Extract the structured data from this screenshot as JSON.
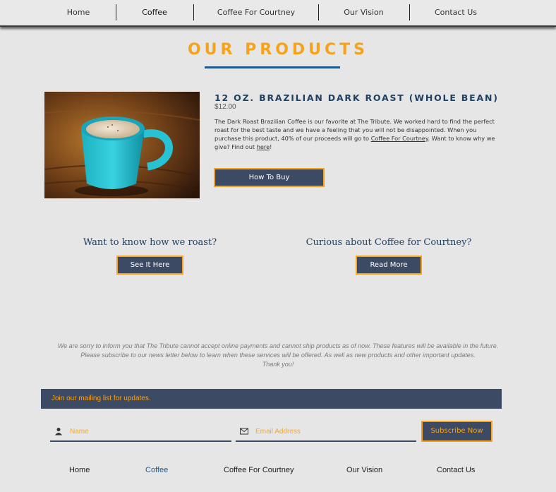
{
  "nav": {
    "items": [
      {
        "label": "Home"
      },
      {
        "label": "Coffee"
      },
      {
        "label": "Coffee For Courtney"
      },
      {
        "label": "Our Vision"
      },
      {
        "label": "Contact Us"
      }
    ]
  },
  "page_title": "OUR PRODUCTS",
  "product": {
    "name": "12 OZ. BRAZILIAN DARK ROAST (WHOLE BEAN)",
    "price": "$12.00",
    "desc_part1": "The Dark Roast Brazilian Coffee is our favorite at The Tribute. We worked hard to find the perfect roast for the best taste and we have a feeling that you will not be disappointed. When you purchase this product, 40% of our proceeds will go to ",
    "desc_link1": "Coffee For Courtney",
    "desc_part2": ". Want to know why we give? Find out ",
    "desc_link2": "here",
    "desc_part3": "!",
    "buy_label": "How To Buy"
  },
  "promos": {
    "roast_heading": "Want to know how we roast?",
    "roast_button": "See It Here",
    "courtney_heading": "Curious about Coffee for Courtney?",
    "courtney_button": "Read More"
  },
  "notice": {
    "line1": "We are sorry to inform you that The Tribute cannot accept online payments and cannot ship products as of now. These features will be available in the future.",
    "line2": "Please subscribe to our news letter below to learn when these services will be offered. As well as new products and other important updates.",
    "line3": "Thank you!"
  },
  "mailing": {
    "heading": "Join our mailing list for updates.",
    "name_placeholder": "Name",
    "email_placeholder": "Email Address",
    "subscribe_label": "Subscribe Now"
  },
  "footer_nav": {
    "items": [
      {
        "label": "Home"
      },
      {
        "label": "Coffee"
      },
      {
        "label": "Coffee For Courtney"
      },
      {
        "label": "Our Vision"
      },
      {
        "label": "Contact Us"
      }
    ]
  },
  "colors": {
    "accent": "#f7a21b",
    "navy": "#3d4a63",
    "heading_blue": "#22405f",
    "active_link": "#1f5a8e"
  }
}
